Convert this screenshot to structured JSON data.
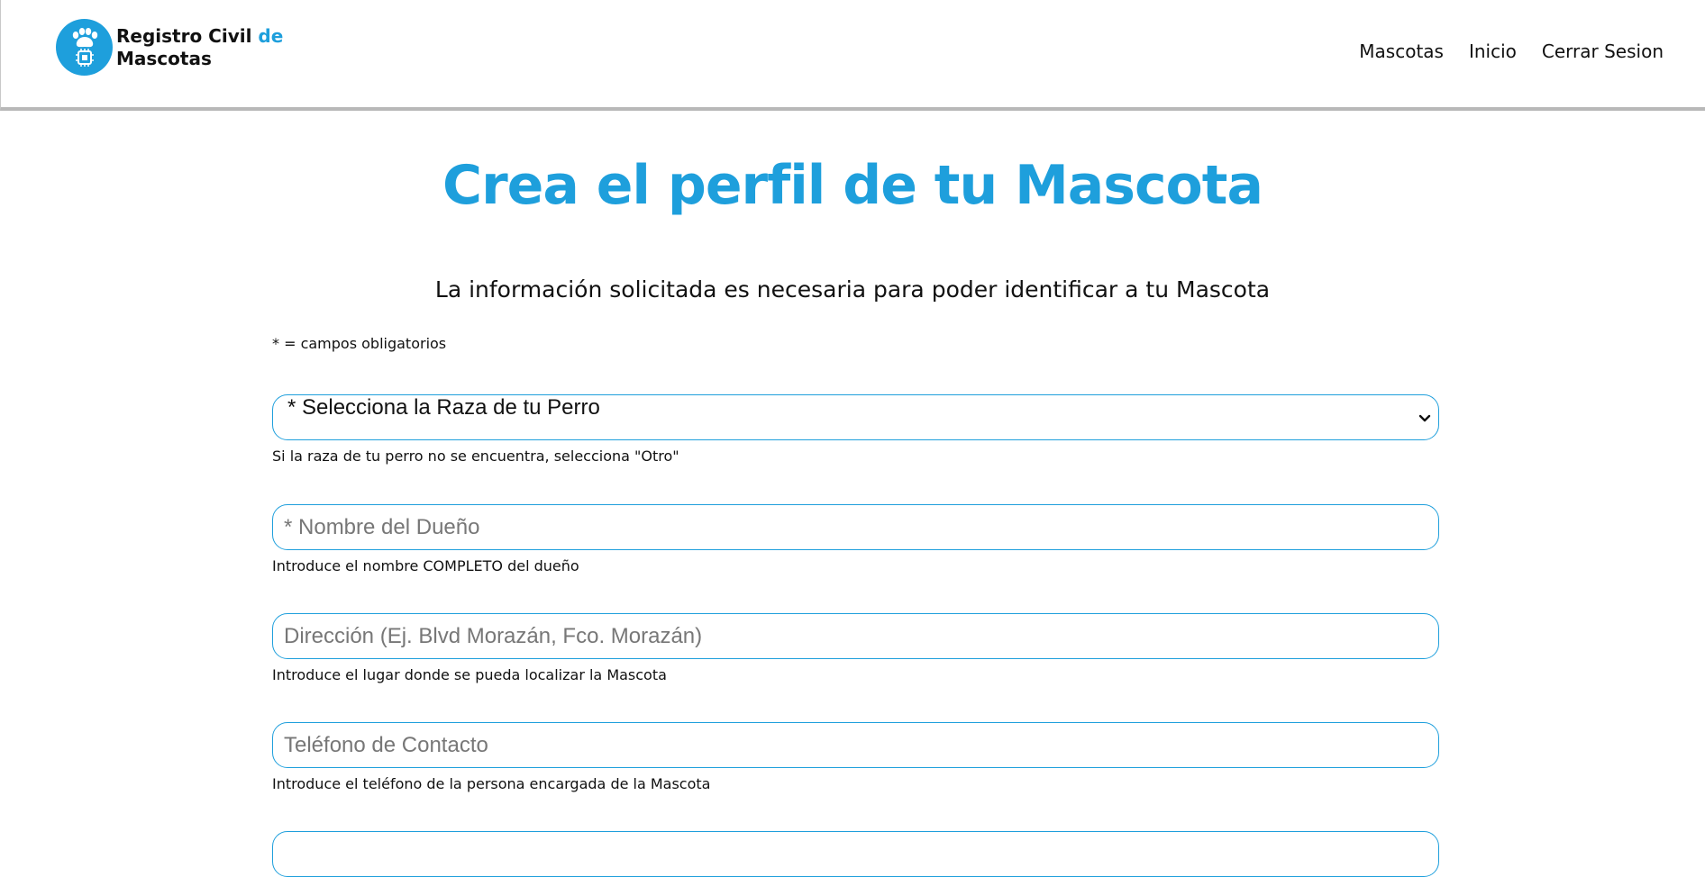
{
  "brand": {
    "name_line1": "Registro Civil",
    "name_accent": "de",
    "name_line2": "Mascotas"
  },
  "nav": {
    "items": [
      "Mascotas",
      "Inicio",
      "Cerrar Sesion"
    ]
  },
  "page": {
    "title": "Crea el perfil de tu Mascota",
    "subtitle": "La información solicitada es necesaria para poder identificar a tu Mascota",
    "required_note": "* = campos obligatorios"
  },
  "form": {
    "breed": {
      "selected": "* Selecciona la Raza de tu Perro",
      "help": "Si la raza de tu perro no se encuentra, selecciona \"Otro\""
    },
    "owner": {
      "placeholder": "* Nombre del Dueño",
      "value": "",
      "help": "Introduce el nombre COMPLETO del dueño"
    },
    "address": {
      "placeholder": "Dirección (Ej. Blvd Morazán, Fco. Morazán)",
      "value": "",
      "help": "Introduce el lugar donde se pueda localizar la Mascota"
    },
    "phone": {
      "placeholder": "Teléfono de Contacto",
      "value": "",
      "help": "Introduce el teléfono de la persona encargada de la Mascota"
    }
  },
  "colors": {
    "accent": "#1e9fdc",
    "text": "#111111",
    "placeholder": "#777777",
    "navbar_border": "#b8b8b8"
  },
  "icons": {
    "logo": "paw-chip-icon",
    "select_arrow": "chevron-down-icon"
  }
}
